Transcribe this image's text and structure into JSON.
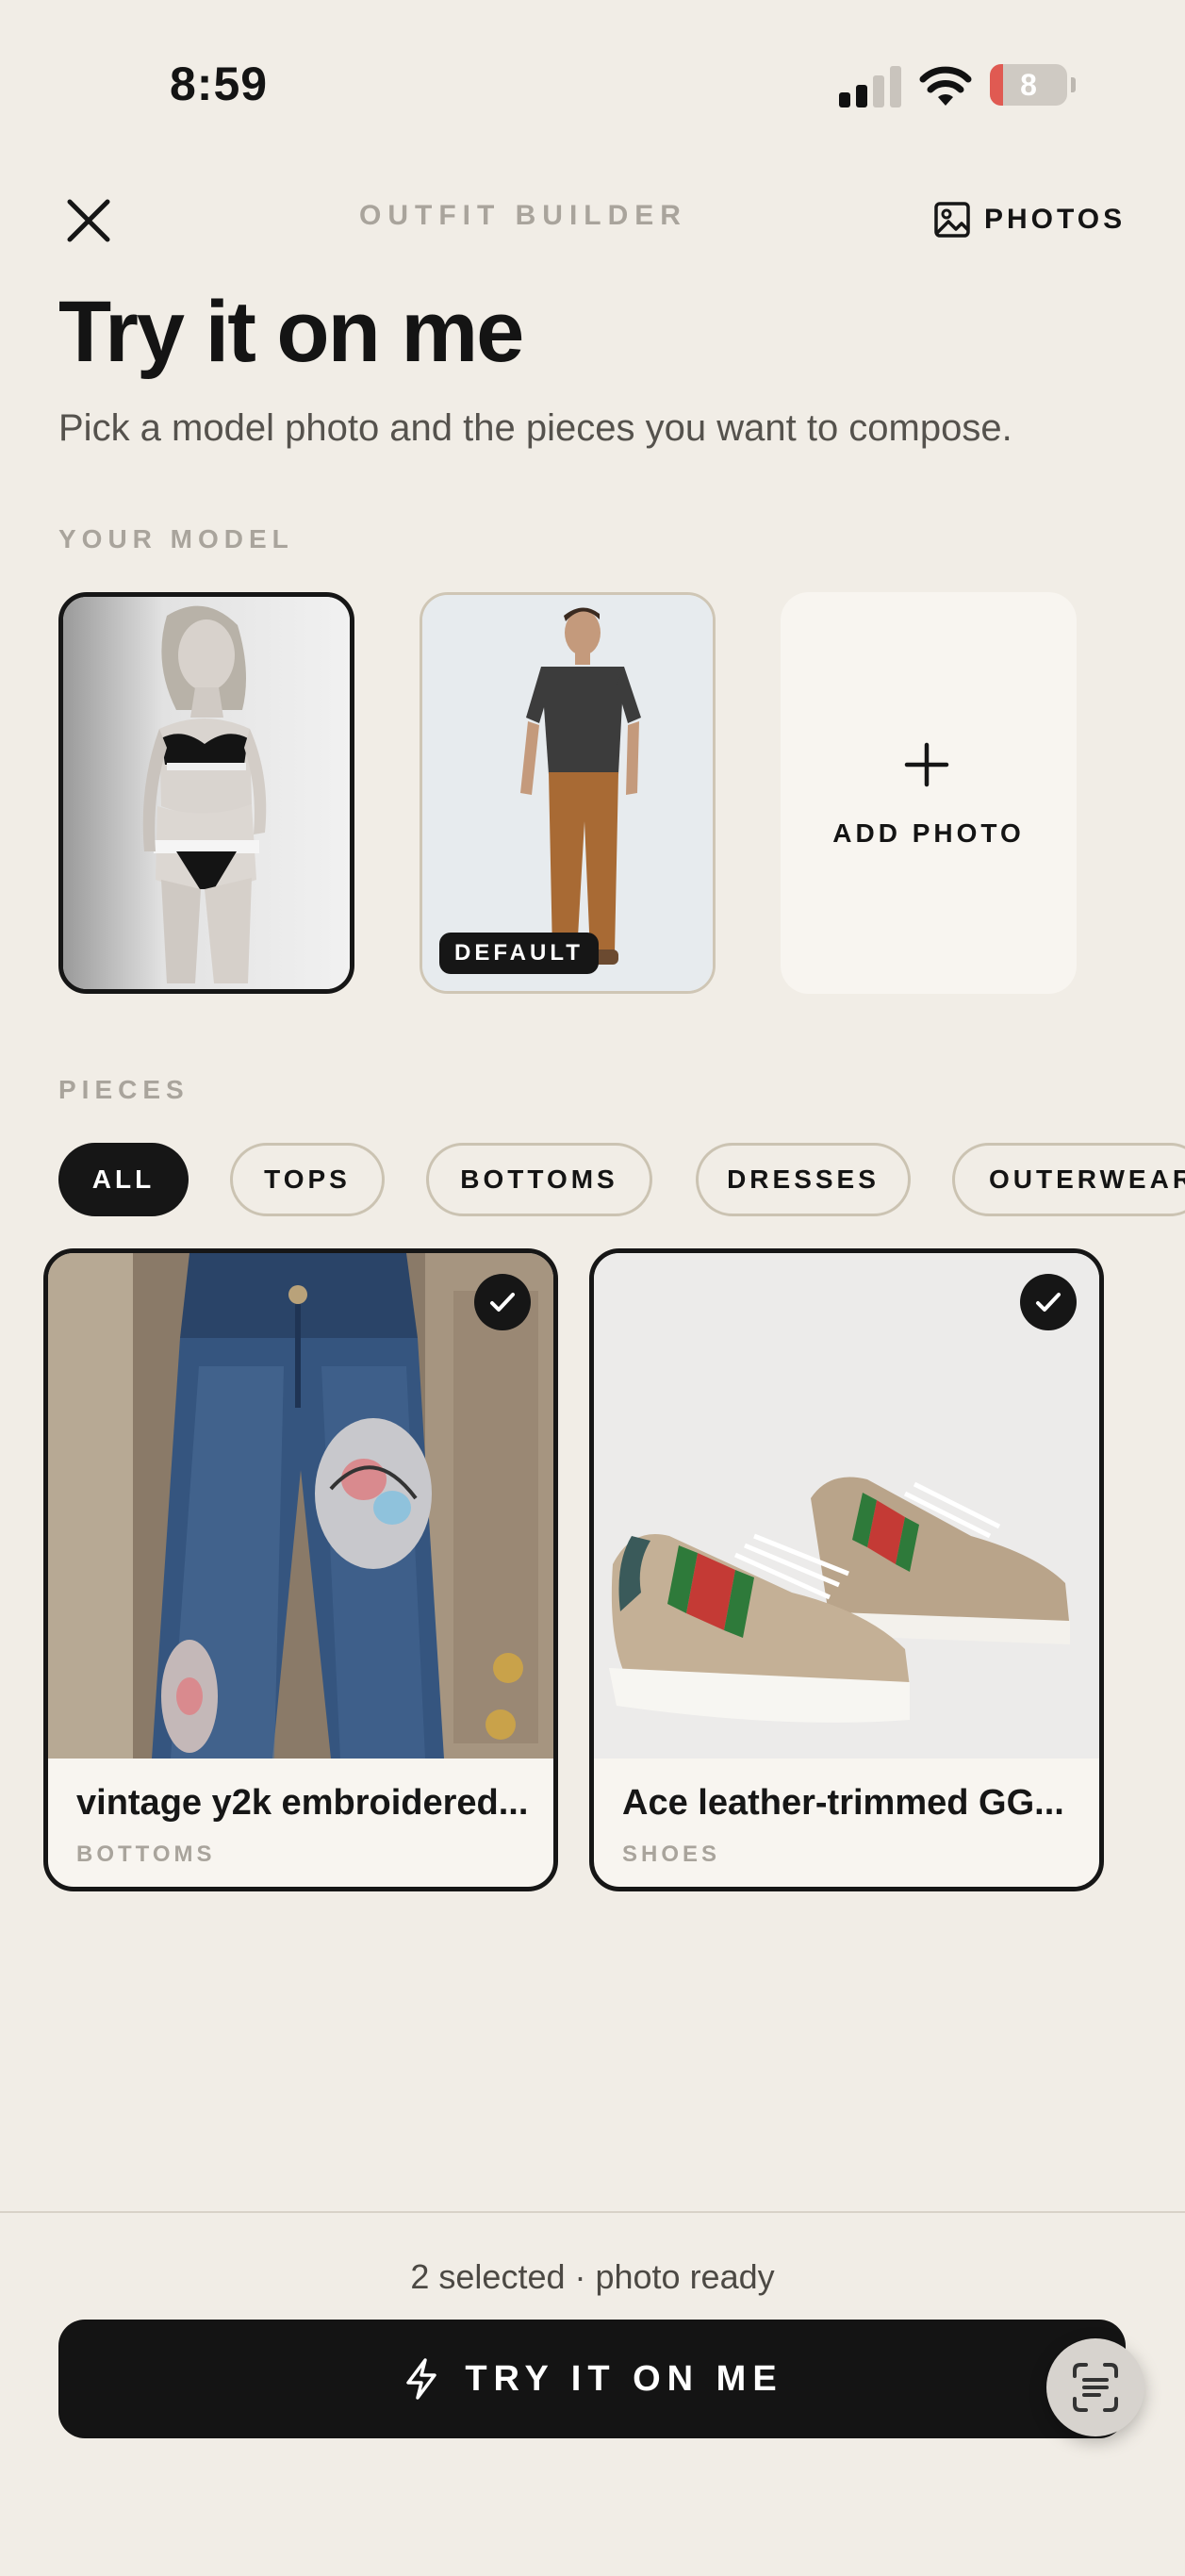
{
  "status_bar": {
    "time": "8:59",
    "battery_level": "8"
  },
  "header": {
    "title": "OUTFIT BUILDER",
    "photos_label": "PHOTOS"
  },
  "page": {
    "title": "Try it on me",
    "subtitle": "Pick a model photo and the pieces you want to compose."
  },
  "models": {
    "section_label": "YOUR MODEL",
    "default_badge": "DEFAULT",
    "add_label": "ADD PHOTO"
  },
  "pieces": {
    "section_label": "PIECES",
    "filters": [
      "ALL",
      "TOPS",
      "BOTTOMS",
      "DRESSES",
      "OUTERWEAR"
    ],
    "active_filter": "ALL",
    "items": [
      {
        "name": "vintage y2k embroidered...",
        "category": "BOTTOMS",
        "selected": true
      },
      {
        "name": "Ace leather-trimmed GG...",
        "category": "SHOES",
        "selected": true
      }
    ]
  },
  "footer": {
    "status": "2 selected · photo ready",
    "cta_label": "TRY IT ON ME"
  },
  "colors": {
    "accent": "#141414",
    "background": "#f1ede6",
    "battery_low": "#e05a52"
  },
  "icons": [
    "close-icon",
    "image-icon",
    "plus-icon",
    "check-icon",
    "lightning-icon",
    "scan-text-icon"
  ]
}
